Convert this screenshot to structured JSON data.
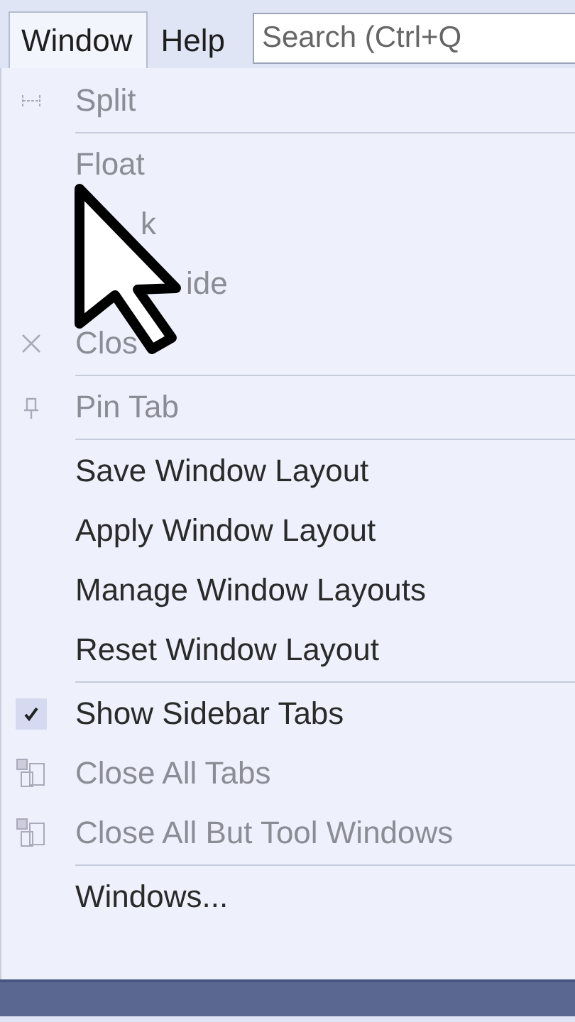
{
  "menubar": {
    "menus": [
      {
        "label": "Window",
        "selected": true
      },
      {
        "label": "Help",
        "selected": false
      }
    ],
    "search": {
      "placeholder": "Search (Ctrl+Q"
    }
  },
  "menu": {
    "groups": [
      [
        {
          "label": "Split",
          "kind": "split",
          "disabled": true
        }
      ],
      [
        {
          "label": "Float",
          "kind": "plain",
          "disabled": true
        },
        {
          "label": "k",
          "kind": "cut",
          "disabled": true
        },
        {
          "label": "ide",
          "kind": "cut-wide",
          "disabled": true
        },
        {
          "label": "Clos",
          "kind": "close",
          "disabled": true
        }
      ],
      [
        {
          "label": "Pin Tab",
          "kind": "pin",
          "disabled": true
        }
      ],
      [
        {
          "label": "Save Window Layout",
          "kind": "plain",
          "disabled": false
        },
        {
          "label": "Apply Window Layout",
          "kind": "plain",
          "disabled": false
        },
        {
          "label": "Manage Window Layouts",
          "kind": "plain",
          "disabled": false
        },
        {
          "label": "Reset Window Layout",
          "kind": "plain",
          "disabled": false
        }
      ],
      [
        {
          "label": "Show Sidebar Tabs",
          "kind": "check",
          "disabled": false,
          "checked": true
        },
        {
          "label": "Close All Tabs",
          "kind": "tabs",
          "disabled": true
        },
        {
          "label": "Close All But Tool Windows",
          "kind": "tabs",
          "disabled": true
        }
      ],
      [
        {
          "label": "Windows...",
          "kind": "plain",
          "disabled": false
        }
      ]
    ]
  }
}
